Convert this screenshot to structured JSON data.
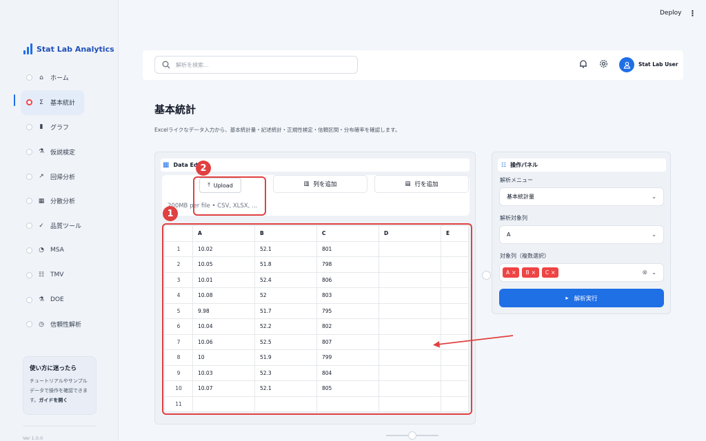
{
  "app": {
    "name": "Stat Lab Analytics",
    "version": "Ver 1.0.0"
  },
  "topbar": {
    "deploy_label": "Deploy",
    "menu_icon": "⋮"
  },
  "sidebar": {
    "items": [
      {
        "label": "ホーム",
        "icon": "⌂"
      },
      {
        "label": "基本統計",
        "icon": "Σ"
      },
      {
        "label": "グラフ",
        "icon": "▮"
      },
      {
        "label": "仮説検定",
        "icon": "⚗"
      },
      {
        "label": "回帰分析",
        "icon": "↗"
      },
      {
        "label": "分散分析",
        "icon": "▦"
      },
      {
        "label": "品質ツール",
        "icon": "✓"
      },
      {
        "label": "MSA",
        "icon": "◔"
      },
      {
        "label": "TMV",
        "icon": "☷"
      },
      {
        "label": "DOE",
        "icon": "⚗"
      },
      {
        "label": "信頼性解析",
        "icon": "◷"
      }
    ],
    "active_index": 1,
    "help": {
      "title": "使い方に迷ったら",
      "text": "チュートリアルやサンプルデータで操作を確認できます。",
      "link": "ガイドを開く"
    }
  },
  "header": {
    "search_placeholder": "解析を検索...",
    "user_name": "Stat Lab User"
  },
  "page": {
    "title": "基本統計",
    "description": "Excelライクなデータ入力から、基本統計量・記述統計・正規性検定・信頼区間・分布確率を確認します。"
  },
  "editor": {
    "title": "Data Ed",
    "upload_label": "Upload",
    "upload_hint": "200MB per file • CSV, XLSX, ...",
    "add_column_label": "列を追加",
    "add_row_label": "行を追加",
    "columns": [
      "",
      "A",
      "B",
      "C",
      "D",
      "E"
    ],
    "rows": [
      [
        "1",
        "10.02",
        "52.1",
        "801",
        "",
        ""
      ],
      [
        "2",
        "10.05",
        "51.8",
        "798",
        "",
        ""
      ],
      [
        "3",
        "10.01",
        "52.4",
        "806",
        "",
        ""
      ],
      [
        "4",
        "10.08",
        "52",
        "803",
        "",
        ""
      ],
      [
        "5",
        "9.98",
        "51.7",
        "795",
        "",
        ""
      ],
      [
        "6",
        "10.04",
        "52.2",
        "802",
        "",
        ""
      ],
      [
        "7",
        "10.06",
        "52.5",
        "807",
        "",
        ""
      ],
      [
        "8",
        "10",
        "51.9",
        "799",
        "",
        ""
      ],
      [
        "9",
        "10.03",
        "52.3",
        "804",
        "",
        ""
      ],
      [
        "10",
        "10.07",
        "52.1",
        "805",
        "",
        ""
      ],
      [
        "11",
        "",
        "",
        "",
        "",
        ""
      ]
    ]
  },
  "panel": {
    "title": "操作パネル",
    "menu_label": "解析メニュー",
    "menu_value": "基本統計量",
    "target_label": "解析対象列",
    "target_value": "A",
    "multi_label": "対象列（複数選択）",
    "chips": [
      "A",
      "B",
      "C"
    ],
    "run_label": "解析実行"
  },
  "annotations": {
    "badge1": "1",
    "badge2": "2"
  },
  "colors": {
    "accent": "#1f6fe5",
    "annotation": "#e04040",
    "chip": "#ef4444"
  }
}
